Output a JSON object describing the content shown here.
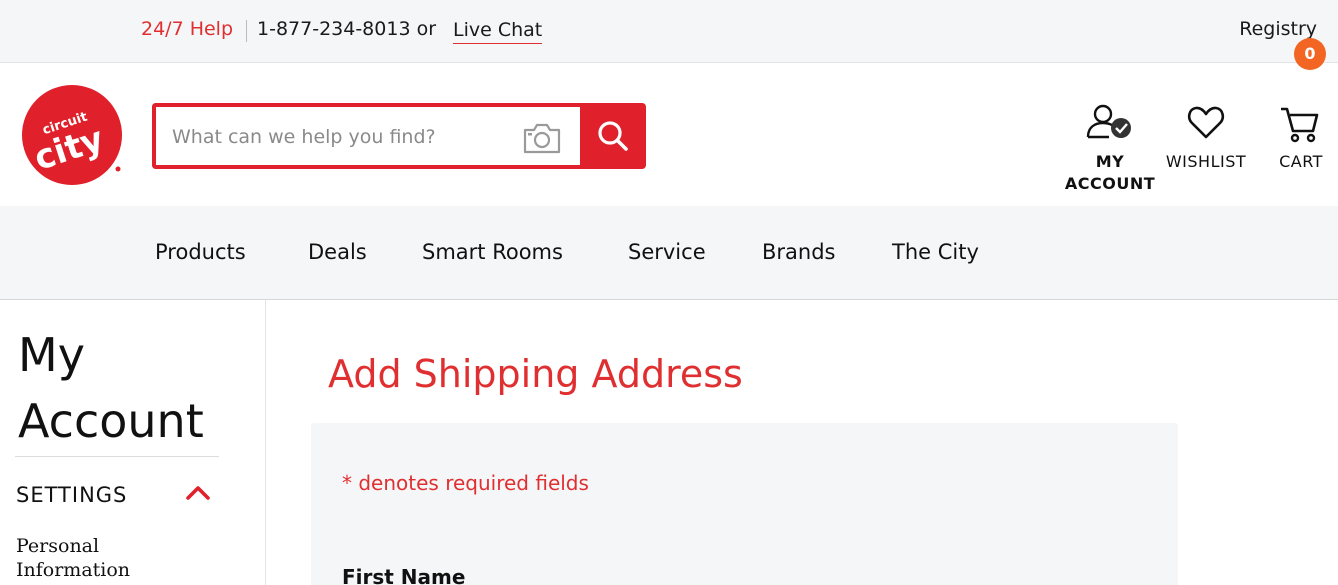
{
  "topbar": {
    "help_label": "24/7 Help",
    "phone_text": "1-877-234-8013 or",
    "live_chat_label": "Live Chat",
    "registry_label": "Registry"
  },
  "header": {
    "search": {
      "placeholder": "What can we help you find?"
    },
    "my_account_line1": "MY",
    "my_account_line2": "ACCOUNT",
    "wishlist_label": "WISHLIST",
    "cart_label": "CART",
    "cart_count": "0",
    "logo_text_top": "circuit",
    "logo_text_main": "city"
  },
  "nav": {
    "items": [
      "Products",
      "Deals",
      "Smart Rooms",
      "Service",
      "Brands",
      "The City"
    ]
  },
  "sidebar": {
    "title_line1": "My",
    "title_line2": "Account",
    "section_label": "SETTINGS",
    "link_line1": "Personal",
    "link_line2": "Information"
  },
  "main": {
    "title": "Add Shipping Address",
    "required_note": "* denotes required fields",
    "first_name_label": "First Name"
  },
  "colors": {
    "brand_red": "#e0202a",
    "accent_red_text": "#e02f30",
    "cart_badge": "#f26522",
    "bar_bg": "#f5f6f8"
  },
  "icons": [
    "camera-icon",
    "search-icon",
    "account-check-icon",
    "heart-icon",
    "cart-icon",
    "chevron-up-icon"
  ]
}
